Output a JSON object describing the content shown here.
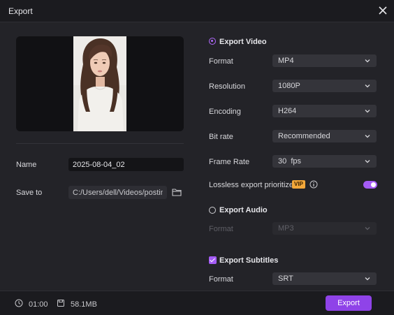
{
  "window": {
    "title": "Export"
  },
  "left": {
    "name_label": "Name",
    "name_value": "2025-08-04_02",
    "save_label": "Save to",
    "save_path": "C:/Users/dell/Videos/posting"
  },
  "video": {
    "heading": "Export Video",
    "format_label": "Format",
    "format_value": "MP4",
    "resolution_label": "Resolution",
    "resolution_value": "1080P",
    "encoding_label": "Encoding",
    "encoding_value": "H264",
    "bitrate_label": "Bit rate",
    "bitrate_value": "Recommended",
    "framerate_label": "Frame Rate",
    "framerate_value": "30  fps",
    "lossless_label": "Lossless export prioritized",
    "vip_badge": "VIP",
    "lossless_on": true
  },
  "audio": {
    "heading": "Export Audio",
    "format_label": "Format",
    "format_value": "MP3"
  },
  "subtitles": {
    "heading": "Export Subtitles",
    "format_label": "Format",
    "format_value": "SRT"
  },
  "footer": {
    "duration": "01:00",
    "size": "58.1MB",
    "export_label": "Export"
  },
  "colors": {
    "accent": "#8f43e8",
    "vip": "#f2a73a",
    "background": "#232328"
  }
}
